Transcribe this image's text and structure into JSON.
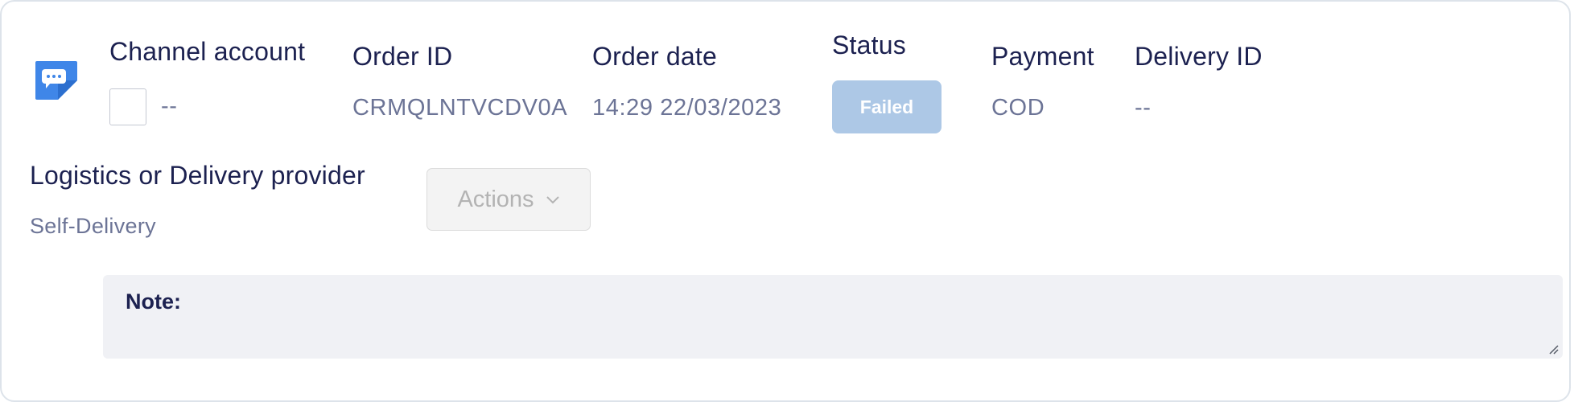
{
  "order": {
    "channel_account": {
      "heading": "Channel account",
      "value": "--"
    },
    "order_id": {
      "heading": "Order ID",
      "value": "CRMQLNTVCDV0A"
    },
    "order_date": {
      "heading": "Order date",
      "value": "14:29 22/03/2023"
    },
    "status": {
      "heading": "Status",
      "value": "Failed"
    },
    "payment": {
      "heading": "Payment",
      "value": "COD"
    },
    "delivery_id": {
      "heading": "Delivery ID",
      "value": "--"
    }
  },
  "logistics": {
    "heading": "Logistics or Delivery provider",
    "value": "Self-Delivery"
  },
  "actions": {
    "label": "Actions",
    "icon": "chevron-down-icon"
  },
  "note": {
    "label": "Note:",
    "value": ""
  },
  "icons": {
    "channel": "chat-bubble-icon"
  },
  "colors": {
    "heading_text": "#1c2150",
    "value_text": "#6c7496",
    "status_failed_bg": "#adc8e6",
    "channel_icon": "#3f86e8",
    "note_bg": "#f0f1f5"
  }
}
